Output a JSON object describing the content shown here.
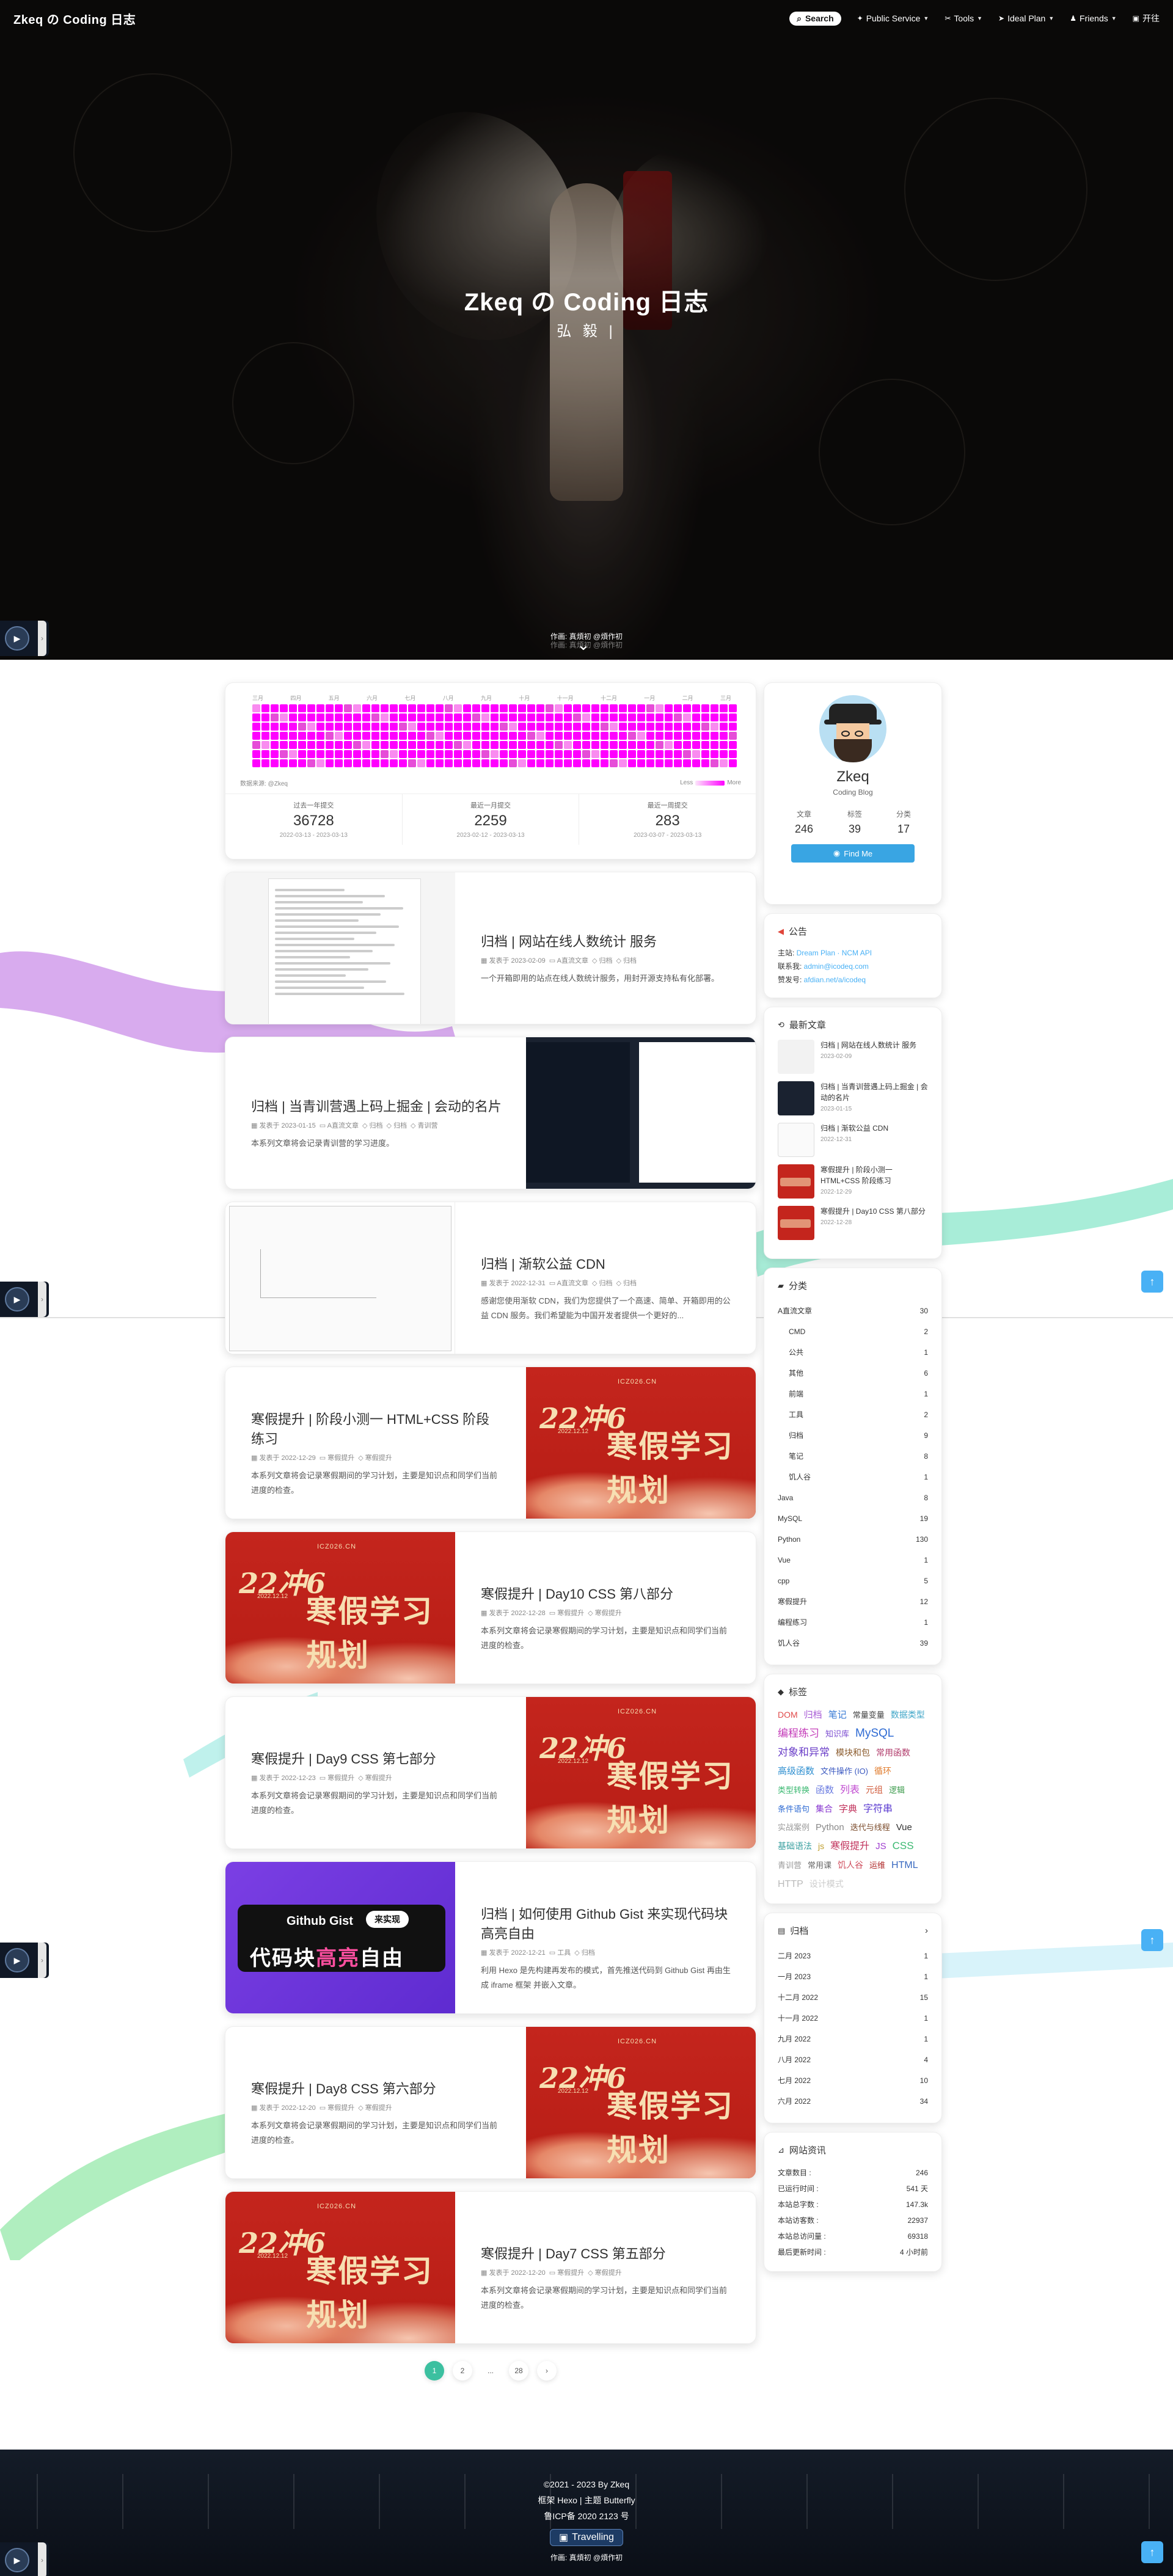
{
  "site": {
    "name": "Zkeq の Coding 日志",
    "subtitle": "弘 毅 |"
  },
  "nav": {
    "search": "Search",
    "items": [
      {
        "label": "Public Service",
        "icon": "wrench-icon"
      },
      {
        "label": "Tools",
        "icon": "tools-icon"
      },
      {
        "label": "Ideal Plan",
        "icon": "send-icon"
      },
      {
        "label": "Friends",
        "icon": "friends-icon"
      },
      {
        "label": "开往",
        "icon": "subway-icon"
      }
    ]
  },
  "hero": {
    "credit_line1": "作画: 真煩初 @煩作初",
    "credit_line2": "作画: 真煩初 @煩作初"
  },
  "heatmap": {
    "months": [
      "三月",
      "四月",
      "五月",
      "六月",
      "七月",
      "八月",
      "九月",
      "十月",
      "十一月",
      "十二月",
      "一月",
      "二月",
      "三月"
    ],
    "source": "数据来源: @Zkeq",
    "legend_less": "Less",
    "legend_more": "More",
    "stats": [
      {
        "label": "过去一年提交",
        "value": "36728",
        "range": "2022-03-13 - 2023-03-13"
      },
      {
        "label": "最近一月提交",
        "value": "2259",
        "range": "2023-02-12 - 2023-03-13"
      },
      {
        "label": "最近一周提交",
        "value": "283",
        "range": "2023-03-07 - 2023-03-13"
      }
    ]
  },
  "posts": [
    {
      "title": "归档 | 网站在线人数统计 服务",
      "meta": [
        "发表于 2023-02-09",
        "A直流文章",
        "归档",
        "归档"
      ],
      "desc": "一个开箱即用的站点在线人数统计服务，用封开源支持私有化部署。",
      "thumb": "doc"
    },
    {
      "title": "归档 | 当青训营遇上码上掘金 | 会动的名片",
      "meta": [
        "发表于 2023-01-15",
        "A直流文章",
        "归档",
        "归档",
        "青训营"
      ],
      "desc": "本系列文章将会记录青训营的学习进度。",
      "thumb": "dark"
    },
    {
      "title": "归档 | 渐软公益 CDN",
      "meta": [
        "发表于 2022-12-31",
        "A直流文章",
        "归档",
        "归档"
      ],
      "desc": "感谢您使用渐软 CDN，我们为您提供了一个高速、简单、开箱即用的公益 CDN 服务。我们希望能为中国开发者提供一个更好的...",
      "thumb": "cdn"
    },
    {
      "title": "寒假提升 | 阶段小测一 HTML+CSS 阶段练习",
      "meta": [
        "发表于 2022-12-29",
        "寒假提升",
        "寒假提升"
      ],
      "desc": "本系列文章将会记录寒假期间的学习计划，主要是知识点和同学们当前进度的检查。",
      "thumb": "red"
    },
    {
      "title": "寒假提升 | Day10 CSS 第八部分",
      "meta": [
        "发表于 2022-12-28",
        "寒假提升",
        "寒假提升"
      ],
      "desc": "本系列文章将会记录寒假期间的学习计划，主要是知识点和同学们当前进度的检查。",
      "thumb": "red"
    },
    {
      "title": "寒假提升 | Day9 CSS 第七部分",
      "meta": [
        "发表于 2022-12-23",
        "寒假提升",
        "寒假提升"
      ],
      "desc": "本系列文章将会记录寒假期间的学习计划，主要是知识点和同学们当前进度的检查。",
      "thumb": "red"
    },
    {
      "title": "归档 | 如何使用 Github Gist 来实现代码块高亮自由",
      "meta": [
        "发表于 2022-12-21",
        "工具",
        "归档"
      ],
      "desc": "利用 Hexo 是先构建再发布的模式，首先推送代码到 Github Gist 再由生成 iframe 框架 并嵌入文章。",
      "thumb": "purple"
    },
    {
      "title": "寒假提升 | Day8 CSS 第六部分",
      "meta": [
        "发表于 2022-12-20",
        "寒假提升",
        "寒假提升"
      ],
      "desc": "本系列文章将会记录寒假期间的学习计划，主要是知识点和同学们当前进度的检查。",
      "thumb": "red"
    },
    {
      "title": "寒假提升 | Day7 CSS 第五部分",
      "meta": [
        "发表于 2022-12-20",
        "寒假提升",
        "寒假提升"
      ],
      "desc": "本系列文章将会记录寒假期间的学习计划，主要是知识点和同学们当前进度的检查。",
      "thumb": "red"
    }
  ],
  "thumb_text": {
    "red_big1": "22冲6",
    "red_big2": "寒假学习规划",
    "red_small": "2022.12.12",
    "red_top": "ICZ026.CN",
    "gist1": "Github Gist",
    "gist_badge": "来实现",
    "gist2a": "代码块",
    "gist2b": "高亮",
    "gist2c": "自由"
  },
  "pagination": [
    "1",
    "2",
    "...",
    "28",
    "›"
  ],
  "author": {
    "name": "Zkeq",
    "desc": "Coding Blog",
    "stats": [
      {
        "label": "文章",
        "value": "246"
      },
      {
        "label": "标签",
        "value": "39"
      },
      {
        "label": "分类",
        "value": "17"
      }
    ],
    "follow": "Find Me"
  },
  "announcement": {
    "title": "公告",
    "rows": [
      {
        "k": "主站:",
        "v": "Dream Plan · NCM API"
      },
      {
        "k": "联系我:",
        "v": "admin@icodeq.com"
      },
      {
        "k": "赞发号:",
        "v": "afdian.net/a/icodeq"
      }
    ]
  },
  "recent": {
    "title": "最新文章",
    "items": [
      {
        "title": "归档 | 网站在线人数统计 服务",
        "date": "2023-02-09",
        "thumb": "doc"
      },
      {
        "title": "归档 | 当青训营遇上码上掘金 | 会动的名片",
        "date": "2023-01-15",
        "thumb": "dark"
      },
      {
        "title": "归档 | 渐软公益 CDN",
        "date": "2022-12-31",
        "thumb": "cdn"
      },
      {
        "title": "寒假提升 | 阶段小测一 HTML+CSS 阶段练习",
        "date": "2022-12-29",
        "thumb": "red"
      },
      {
        "title": "寒假提升 | Day10 CSS 第八部分",
        "date": "2022-12-28",
        "thumb": "red"
      }
    ]
  },
  "categories": {
    "title": "分类",
    "items": [
      {
        "name": "A直流文章",
        "count": "30",
        "sub": false
      },
      {
        "name": "CMD",
        "count": "2",
        "sub": true
      },
      {
        "name": "公共",
        "count": "1",
        "sub": true
      },
      {
        "name": "其他",
        "count": "6",
        "sub": true
      },
      {
        "name": "前端",
        "count": "1",
        "sub": true
      },
      {
        "name": "工具",
        "count": "2",
        "sub": true
      },
      {
        "name": "归档",
        "count": "9",
        "sub": true
      },
      {
        "name": "笔记",
        "count": "8",
        "sub": true
      },
      {
        "name": "饥人谷",
        "count": "1",
        "sub": true
      },
      {
        "name": "Java",
        "count": "8",
        "sub": false
      },
      {
        "name": "MySQL",
        "count": "19",
        "sub": false
      },
      {
        "name": "Python",
        "count": "130",
        "sub": false
      },
      {
        "name": "Vue",
        "count": "1",
        "sub": false
      },
      {
        "name": "cpp",
        "count": "5",
        "sub": false
      },
      {
        "name": "寒假提升",
        "count": "12",
        "sub": false
      },
      {
        "name": "编程练习",
        "count": "1",
        "sub": false
      },
      {
        "name": "饥人谷",
        "count": "39",
        "sub": false
      }
    ]
  },
  "tags": {
    "title": "标签",
    "items": [
      {
        "t": "DOM",
        "c": "#e04a4a",
        "s": 14
      },
      {
        "t": "归档",
        "c": "#a85cd6",
        "s": 15
      },
      {
        "t": "笔记",
        "c": "#3a7bd5",
        "s": 15
      },
      {
        "t": "常量变量",
        "c": "#444",
        "s": 13
      },
      {
        "t": "数据类型",
        "c": "#3fa6c8",
        "s": 14
      },
      {
        "t": "编程练习",
        "c": "#c33ab8",
        "s": 17
      },
      {
        "t": "知识库",
        "c": "#7b4bd0",
        "s": 13
      },
      {
        "t": "MySQL",
        "c": "#2f6bd3",
        "s": 19
      },
      {
        "t": "对象和异常",
        "c": "#6b3fc8",
        "s": 17
      },
      {
        "t": "模块和包",
        "c": "#8a5a2b",
        "s": 14
      },
      {
        "t": "常用函数",
        "c": "#b03a6a",
        "s": 14
      },
      {
        "t": "高级函数",
        "c": "#2f8fd0",
        "s": 15
      },
      {
        "t": "文件操作 (IO)",
        "c": "#3a58c0",
        "s": 13
      },
      {
        "t": "循环",
        "c": "#e07a2a",
        "s": 14
      },
      {
        "t": "类型转换",
        "c": "#3ab870",
        "s": 13
      },
      {
        "t": "函数",
        "c": "#6a7be0",
        "s": 15
      },
      {
        "t": "列表",
        "c": "#c04ad0",
        "s": 16
      },
      {
        "t": "元组",
        "c": "#d05a3a",
        "s": 14
      },
      {
        "t": "逻辑",
        "c": "#3a9a4a",
        "s": 13
      },
      {
        "t": "条件语句",
        "c": "#2f6bd3",
        "s": 13
      },
      {
        "t": "集合",
        "c": "#8a3ad0",
        "s": 14
      },
      {
        "t": "字典",
        "c": "#c0305a",
        "s": 15
      },
      {
        "t": "字符串",
        "c": "#5a3ad0",
        "s": 16
      },
      {
        "t": "实战案例",
        "c": "#999",
        "s": 13
      },
      {
        "t": "Python",
        "c": "#888",
        "s": 15
      },
      {
        "t": "迭代与线程",
        "c": "#7a4a2a",
        "s": 13
      },
      {
        "t": "Vue",
        "c": "#333",
        "s": 15
      },
      {
        "t": "基础语法",
        "c": "#3aa0a0",
        "s": 14
      },
      {
        "t": "js",
        "c": "#c0a030",
        "s": 14
      },
      {
        "t": "寒假提升",
        "c": "#c0305a",
        "s": 16
      },
      {
        "t": "JS",
        "c": "#a040d0",
        "s": 15
      },
      {
        "t": "CSS",
        "c": "#3ab870",
        "s": 17
      },
      {
        "t": "青训营",
        "c": "#999",
        "s": 13
      },
      {
        "t": "常用课",
        "c": "#666",
        "s": 13
      },
      {
        "t": "饥人谷",
        "c": "#d05060",
        "s": 14
      },
      {
        "t": "运维",
        "c": "#b02a2a",
        "s": 13
      },
      {
        "t": "HTML",
        "c": "#3a6ac0",
        "s": 16
      },
      {
        "t": "HTTP",
        "c": "#bbb",
        "s": 16
      },
      {
        "t": "设计模式",
        "c": "#ccc",
        "s": 14
      }
    ]
  },
  "archives": {
    "title": "归档",
    "items": [
      {
        "m": "二月 2023",
        "n": "1"
      },
      {
        "m": "一月 2023",
        "n": "1"
      },
      {
        "m": "十二月 2022",
        "n": "15"
      },
      {
        "m": "十一月 2022",
        "n": "1"
      },
      {
        "m": "九月 2022",
        "n": "1"
      },
      {
        "m": "八月 2022",
        "n": "4"
      },
      {
        "m": "七月 2022",
        "n": "10"
      },
      {
        "m": "六月 2022",
        "n": "34"
      }
    ]
  },
  "siteinfo": {
    "title": "网站资讯",
    "items": [
      {
        "k": "文章数目 :",
        "v": "246"
      },
      {
        "k": "已运行时间 :",
        "v": "541 天"
      },
      {
        "k": "本站总字数 :",
        "v": "147.3k"
      },
      {
        "k": "本站访客数 :",
        "v": "22937"
      },
      {
        "k": "本站总访问量 :",
        "v": "69318"
      },
      {
        "k": "最后更新时间 :",
        "v": "4 小时前"
      }
    ]
  },
  "footer": {
    "copyright": "©2021 - 2023 By Zkeq",
    "powered": "框架 Hexo | 主题 Butterfly",
    "icp": "鲁ICP备 2020 2123 号",
    "travel": "Travelling",
    "credit": "作画: 真煩初 @煩作初"
  },
  "colors": {
    "accent": "#49b1f5",
    "heat": "#ff00ff",
    "teal": "#3cc0a0"
  }
}
